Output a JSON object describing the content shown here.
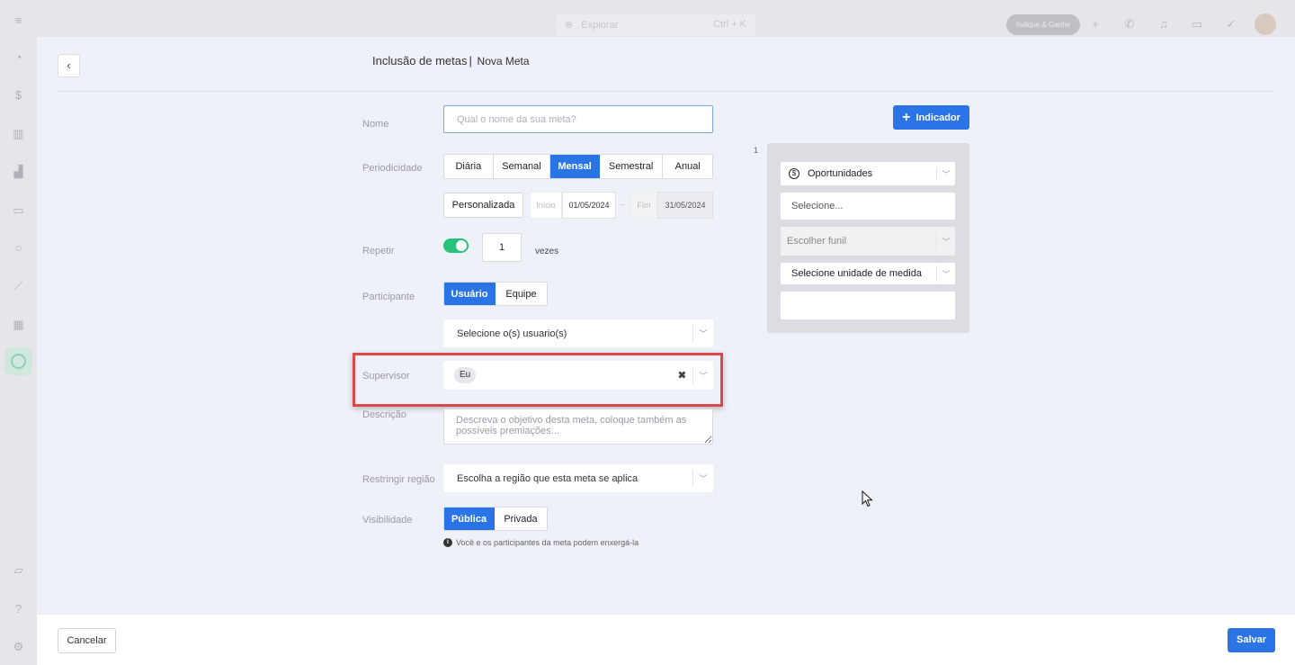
{
  "topbar": {
    "explore_placeholder": "Explorar",
    "explore_shortcut": "Ctrl + K",
    "indique_label": "Indique & Ganhe"
  },
  "header": {
    "title": "Inclusão de metas",
    "separator": "|",
    "subtitle": "Nova Meta"
  },
  "form": {
    "nome": {
      "label": "Nome",
      "placeholder": "Qual o nome da sua meta?"
    },
    "periodicidade": {
      "label": "Periodicidade",
      "options": [
        "Diária",
        "Semanal",
        "Mensal",
        "Semestral",
        "Anual"
      ],
      "selected": "Mensal",
      "custom_label": "Personalizada",
      "start_label": "Início",
      "start_value": "01/05/2024",
      "range_sep": "–",
      "end_label": "Fim",
      "end_value": "31/05/2024"
    },
    "repetir": {
      "label": "Repetir",
      "enabled": true,
      "value": "1",
      "suffix": "vezes"
    },
    "participante": {
      "label": "Participante",
      "options": [
        "Usuário",
        "Equipe"
      ],
      "selected": "Usuário",
      "users_placeholder": "Selecione o(s) usuario(s)"
    },
    "supervisor": {
      "label": "Supervisor",
      "chip": "Eu"
    },
    "descricao": {
      "label": "Descrição",
      "placeholder": "Descreva o objetivo desta meta, coloque também as possíveis premiações..."
    },
    "regiao": {
      "label": "Restringir região",
      "placeholder": "Escolha a região que esta meta se aplica"
    },
    "visibilidade": {
      "label": "Visibilidade",
      "options": [
        "Pública",
        "Privada"
      ],
      "selected": "Pública",
      "info": "Você e os participantes da meta podem enxergá-la"
    }
  },
  "indicator": {
    "button_label": "Indicador",
    "number": "1",
    "type": "Oportunidades",
    "select_placeholder": "Selecione...",
    "funnel_placeholder": "Escolher funil",
    "unit_placeholder": "Selecione unidade de medida"
  },
  "footer": {
    "cancel_label": "Cancelar",
    "save_label": "Salvar"
  },
  "colors": {
    "primary": "#2a74e6",
    "toggle_on": "#29c27a",
    "highlight": "#d94949"
  }
}
